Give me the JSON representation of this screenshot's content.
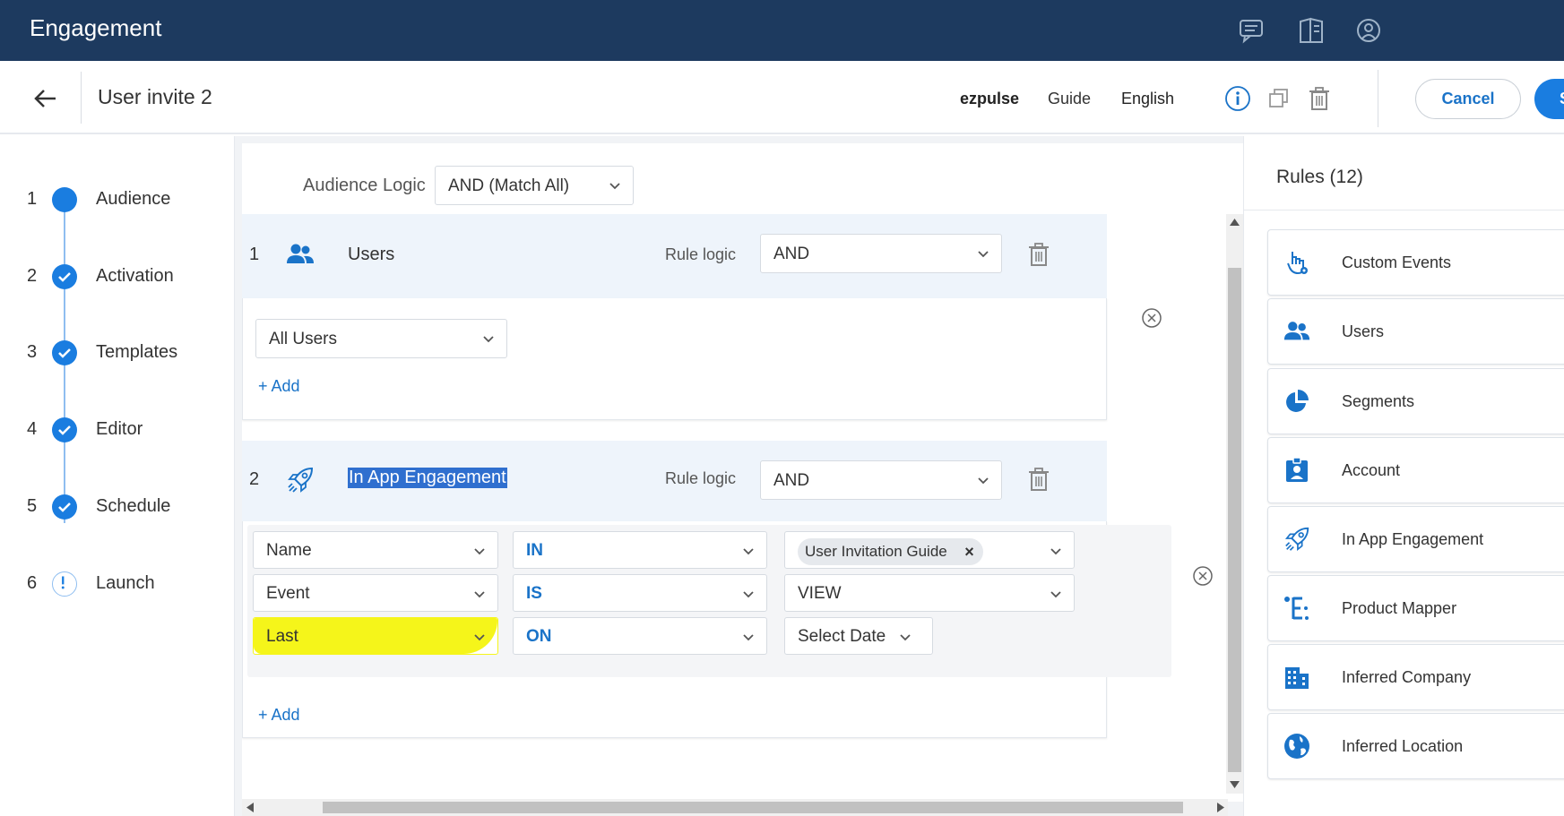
{
  "app": {
    "title": "Engagement"
  },
  "header": {
    "title": "User invite 2",
    "app_name": "ezpulse",
    "type": "Guide",
    "language": "English",
    "cancel_label": "Cancel",
    "save_label": "S"
  },
  "steps": [
    {
      "num": "1",
      "label": "Audience",
      "state": "current"
    },
    {
      "num": "2",
      "label": "Activation",
      "state": "done"
    },
    {
      "num": "3",
      "label": "Templates",
      "state": "done"
    },
    {
      "num": "4",
      "label": "Editor",
      "state": "done"
    },
    {
      "num": "5",
      "label": "Schedule",
      "state": "done"
    },
    {
      "num": "6",
      "label": "Launch",
      "state": "warning"
    }
  ],
  "audience": {
    "logic_label": "Audience Logic",
    "logic_value": "AND (Match All)",
    "rules": [
      {
        "num": "1",
        "name": "Users",
        "icon": "users-icon",
        "logic_label": "Rule logic",
        "logic_value": "AND",
        "filter": "All Users",
        "add_label": "+ Add"
      },
      {
        "num": "2",
        "name": "In App Engagement",
        "icon": "rocket-icon",
        "logic_label": "Rule logic",
        "logic_value": "AND",
        "conditions": [
          {
            "field": "Name",
            "operator": "IN",
            "value": "User Invitation Guide",
            "value_remove": "×"
          },
          {
            "field": "Event",
            "operator": "IS",
            "value": "VIEW"
          },
          {
            "field": "Last",
            "operator": "ON",
            "value": "Select Date"
          }
        ],
        "add_label": "+ Add"
      }
    ]
  },
  "rules_panel": {
    "title": "Rules (12)",
    "items": [
      {
        "label": "Custom Events",
        "icon": "touch-gear-icon"
      },
      {
        "label": "Users",
        "icon": "users-icon"
      },
      {
        "label": "Segments",
        "icon": "pie-chart-icon"
      },
      {
        "label": "Account",
        "icon": "badge-icon"
      },
      {
        "label": "In App Engagement",
        "icon": "rocket-icon"
      },
      {
        "label": "Product Mapper",
        "icon": "mapper-icon"
      },
      {
        "label": "Inferred Company",
        "icon": "building-icon"
      },
      {
        "label": "Inferred Location",
        "icon": "globe-icon"
      }
    ]
  },
  "colors": {
    "topbar": "#1d3a5f",
    "accent": "#1a73c8",
    "highlight": "#f5f51a"
  }
}
